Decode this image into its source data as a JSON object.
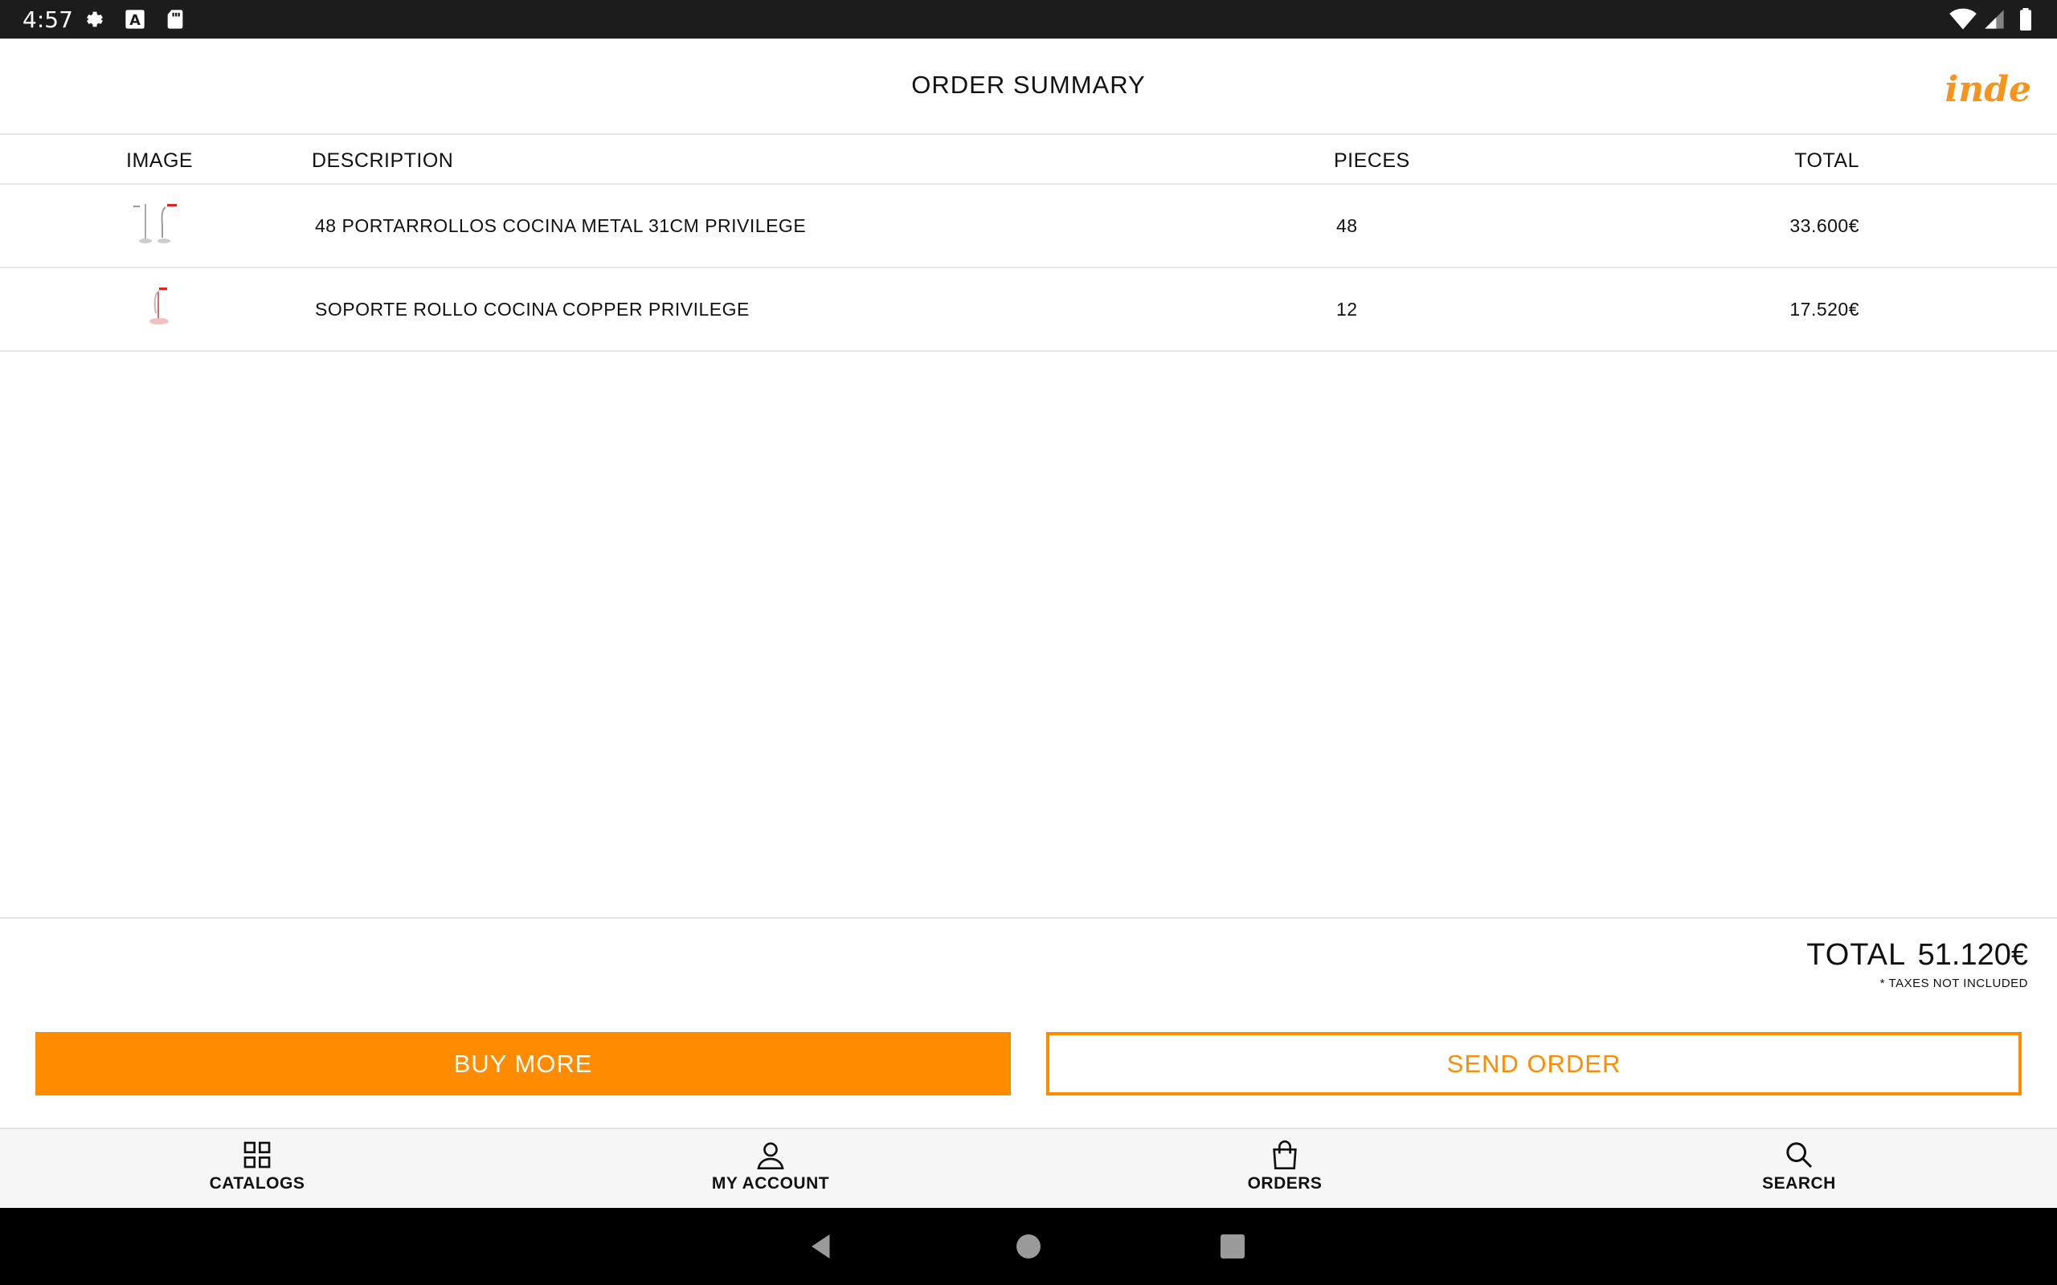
{
  "status_bar": {
    "time": "4:57",
    "icons": [
      "gear-icon",
      "font-icon",
      "sd-card-icon",
      "wifi-icon",
      "signal-icon",
      "battery-icon"
    ]
  },
  "header": {
    "title": "ORDER SUMMARY",
    "logo_text": "inde"
  },
  "table": {
    "columns": [
      "IMAGE",
      "DESCRIPTION",
      "PIECES",
      "TOTAL"
    ],
    "rows": [
      {
        "description": "48 PORTARROLLOS COCINA METAL 31CM PRIVILEGE",
        "pieces": "48",
        "total": "33.600€"
      },
      {
        "description": "SOPORTE ROLLO COCINA COPPER PRIVILEGE",
        "pieces": "12",
        "total": "17.520€"
      }
    ]
  },
  "summary": {
    "total_label": "TOTAL",
    "total_value": "51.120€",
    "tax_note": "* TAXES NOT INCLUDED"
  },
  "buttons": {
    "buy_more": "BUY MORE",
    "send_order": "SEND ORDER"
  },
  "bottom_nav": [
    {
      "label": "CATALOGS",
      "icon": "grid-icon"
    },
    {
      "label": "MY ACCOUNT",
      "icon": "user-icon"
    },
    {
      "label": "ORDERS",
      "icon": "bag-icon"
    },
    {
      "label": "SEARCH",
      "icon": "search-icon"
    }
  ],
  "colors": {
    "accent": "#ff8c00",
    "logo": "#f7941d",
    "status_bar": "#1c1c1c"
  }
}
